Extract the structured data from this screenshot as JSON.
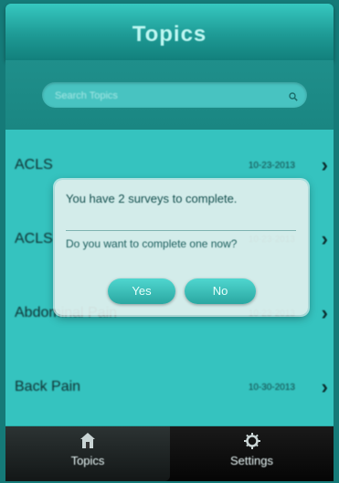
{
  "header": {
    "title": "Topics"
  },
  "search": {
    "placeholder": "Search Topics"
  },
  "topics": [
    {
      "name": "ACLS",
      "date": "10-23-2013"
    },
    {
      "name": "ACLS",
      "date": "10-23-2013"
    },
    {
      "name": "Abdominal Pain",
      "date": "10-23-2013"
    },
    {
      "name": "Back Pain",
      "date": "10-30-2013"
    }
  ],
  "dialog": {
    "message": "You have 2 surveys to complete.",
    "question": "Do you want to complete one now?",
    "yes_label": "Yes",
    "no_label": "No"
  },
  "tabbar": {
    "topics_label": "Topics",
    "settings_label": "Settings"
  },
  "colors": {
    "accent": "#2fbcb8",
    "header": "#1e9a95",
    "tabbar": "#0b0b0b"
  }
}
